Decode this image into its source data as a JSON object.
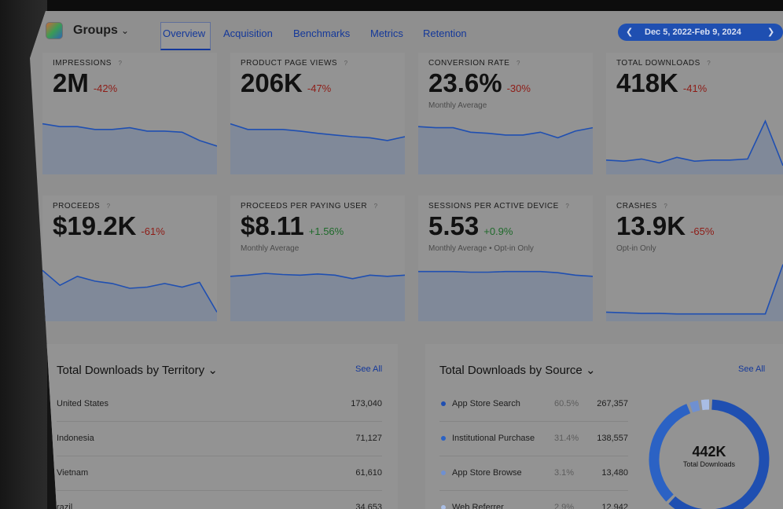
{
  "app": {
    "name": "Groups"
  },
  "nav": {
    "tabs": [
      {
        "label": "Overview"
      },
      {
        "label": "Acquisition"
      },
      {
        "label": "Benchmarks"
      },
      {
        "label": "Metrics"
      },
      {
        "label": "Retention"
      }
    ],
    "date_range": "Dec 5, 2022-Feb 9, 2024"
  },
  "metrics": [
    {
      "title": "IMPRESSIONS",
      "value": "2M",
      "change": "-42%",
      "sub": "",
      "spark": [
        0.85,
        0.8,
        0.8,
        0.75,
        0.75,
        0.78,
        0.72,
        0.72,
        0.7,
        0.55,
        0.45
      ]
    },
    {
      "title": "PRODUCT PAGE VIEWS",
      "value": "206K",
      "change": "-47%",
      "sub": "",
      "spark": [
        0.85,
        0.75,
        0.75,
        0.75,
        0.72,
        0.68,
        0.65,
        0.62,
        0.6,
        0.55,
        0.62
      ]
    },
    {
      "title": "CONVERSION RATE",
      "value": "23.6%",
      "change": "-30%",
      "sub": "Monthly Average",
      "spark": [
        0.8,
        0.78,
        0.78,
        0.7,
        0.68,
        0.65,
        0.65,
        0.7,
        0.6,
        0.72,
        0.78
      ]
    },
    {
      "title": "TOTAL DOWNLOADS",
      "value": "418K",
      "change": "-41%",
      "sub": "",
      "spark": [
        0.2,
        0.18,
        0.22,
        0.15,
        0.25,
        0.18,
        0.2,
        0.2,
        0.22,
        0.9,
        0.1
      ]
    },
    {
      "title": "PROCEEDS",
      "value": "$19.2K",
      "change": "-61%",
      "sub": "",
      "spark": [
        0.8,
        0.55,
        0.7,
        0.62,
        0.58,
        0.5,
        0.52,
        0.58,
        0.52,
        0.6,
        0.1
      ]
    },
    {
      "title": "PROCEEDS PER PAYING USER",
      "value": "$8.11",
      "change": "+1.56%",
      "sub": "Monthly Average",
      "spark": [
        0.7,
        0.72,
        0.75,
        0.73,
        0.72,
        0.74,
        0.72,
        0.66,
        0.72,
        0.7,
        0.72
      ]
    },
    {
      "title": "SESSIONS PER ACTIVE DEVICE",
      "value": "5.53",
      "change": "+0.9%",
      "sub": "Monthly Average • Opt-in Only",
      "spark": [
        0.78,
        0.78,
        0.78,
        0.77,
        0.77,
        0.78,
        0.78,
        0.78,
        0.76,
        0.72,
        0.7
      ]
    },
    {
      "title": "CRASHES",
      "value": "13.9K",
      "change": "-65%",
      "sub": "Opt-in Only",
      "spark": [
        0.1,
        0.09,
        0.08,
        0.08,
        0.07,
        0.07,
        0.07,
        0.07,
        0.07,
        0.07,
        0.9
      ]
    }
  ],
  "territory": {
    "title": "Total Downloads by Territory",
    "see_all": "See All",
    "rows": [
      {
        "name": "United States",
        "value": "173,040"
      },
      {
        "name": "Indonesia",
        "value": "71,127"
      },
      {
        "name": "Vietnam",
        "value": "61,610"
      },
      {
        "name": "razil",
        "value": "34,653"
      }
    ]
  },
  "source": {
    "title": "Total Downloads by Source",
    "see_all": "See All",
    "rows": [
      {
        "name": "App Store Search",
        "pct": "60.5%",
        "value": "267,357"
      },
      {
        "name": "Institutional Purchase",
        "pct": "31.4%",
        "value": "138,557"
      },
      {
        "name": "App Store Browse",
        "pct": "3.1%",
        "value": "13,480"
      },
      {
        "name": "Web Referrer",
        "pct": "2.9%",
        "value": "12,942"
      }
    ],
    "donut_total": "442K",
    "donut_label": "Total Downloads",
    "donut_shares": [
      60.5,
      31.4,
      3.1,
      2.9
    ]
  },
  "colors": {
    "accent": "#1f4fb1",
    "negative": "#8e1c16",
    "positive": "#1f6a2b",
    "spark_line": "#1f4fb1",
    "donut": [
      "#1f4fb1",
      "#2b62c4",
      "#6f90d1",
      "#a9bde4"
    ]
  }
}
